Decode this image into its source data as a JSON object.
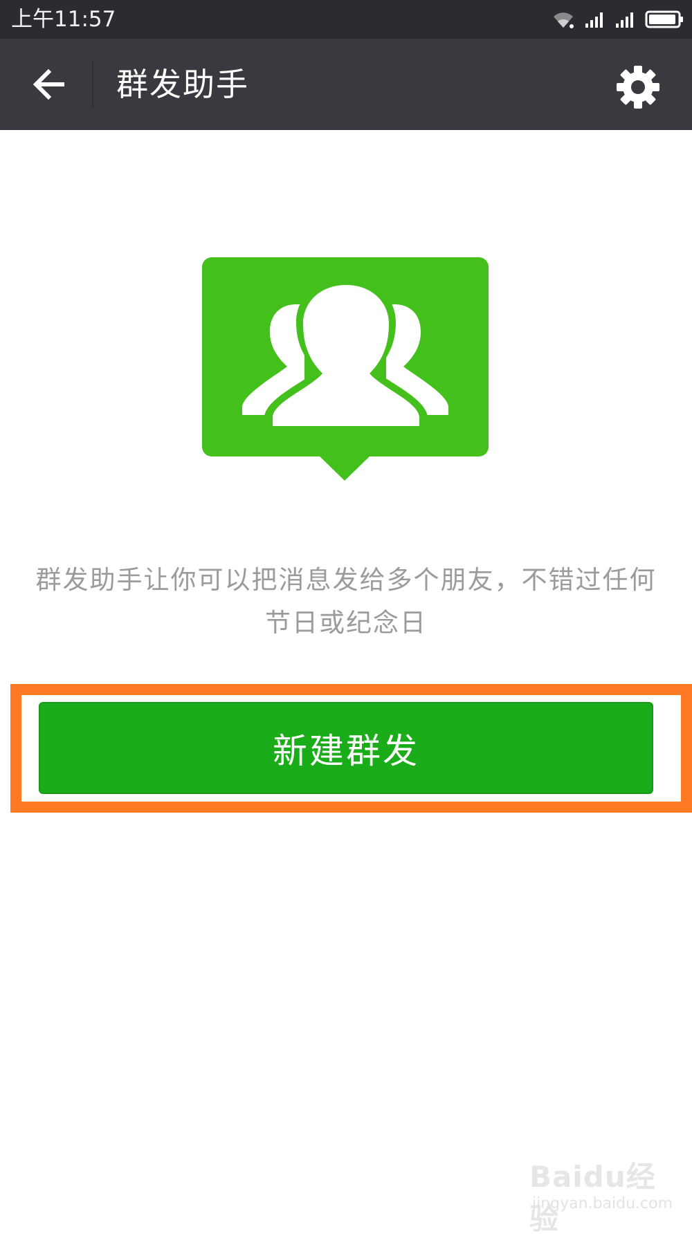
{
  "status_bar": {
    "time": "上午11:57",
    "icons": [
      "wifi-icon",
      "signal-icon",
      "signal-icon",
      "battery-icon"
    ]
  },
  "app_bar": {
    "back_icon": "arrow-left-icon",
    "title": "群发助手",
    "settings_icon": "gear-icon"
  },
  "hero": {
    "icon": "group-contacts-icon",
    "color": "#44c01c"
  },
  "main": {
    "description_line1": "群发助手让你可以把消息发给多个朋友，不错过任何",
    "description_line2": "节日或纪念日",
    "new_broadcast_label": "新建群发"
  },
  "colors": {
    "appbar": "#393a3f",
    "statusbar": "#2b2c31",
    "button": "#1aac19",
    "highlight": "#ff7a22"
  },
  "watermark": {
    "logo": "Baidu经验",
    "url": "jingyan.baidu.com"
  }
}
